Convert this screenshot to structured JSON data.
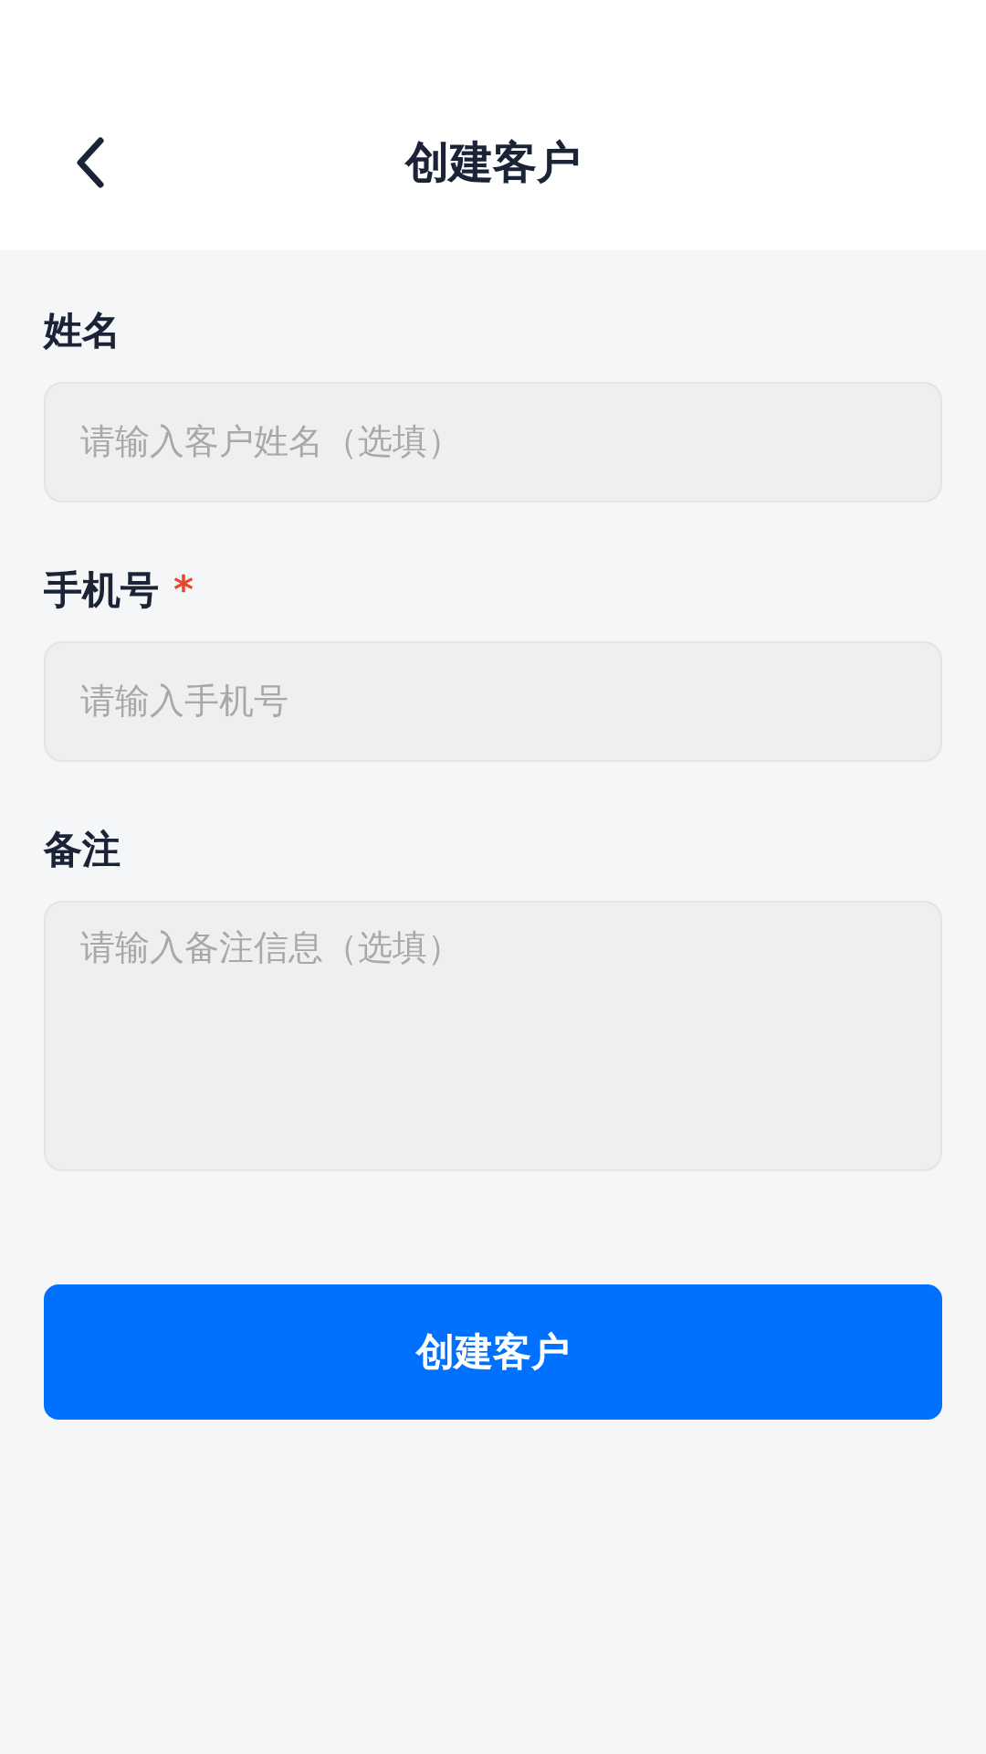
{
  "header": {
    "title": "创建客户"
  },
  "fields": [
    {
      "label": "姓名",
      "kind": "input",
      "placeholder": "请输入客户姓名（选填）"
    },
    {
      "label": "手机号",
      "required_mark": "*",
      "kind": "input",
      "placeholder": "请输入手机号"
    },
    {
      "label": "备注",
      "kind": "textarea",
      "placeholder": "请输入备注信息（选填）"
    }
  ],
  "submit": {
    "label": "创建客户"
  }
}
